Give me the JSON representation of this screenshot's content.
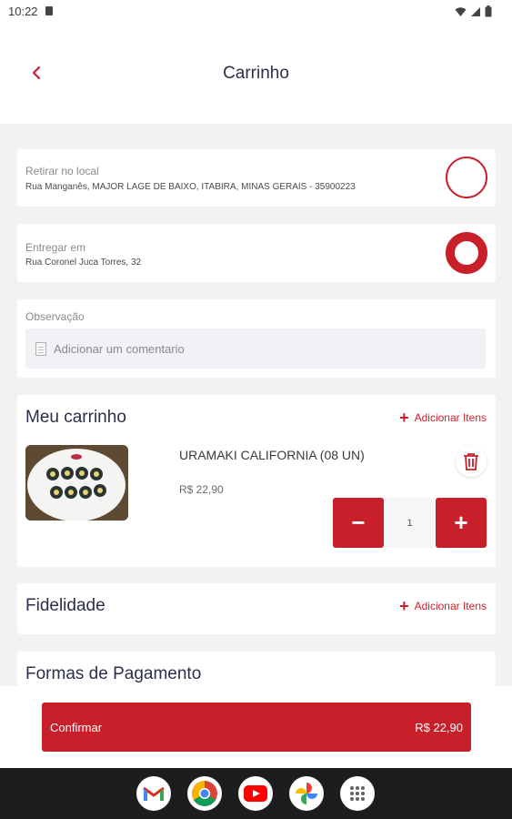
{
  "status_bar": {
    "time": "10:22"
  },
  "header": {
    "title": "Carrinho"
  },
  "pickup": {
    "label": "Retirar no local",
    "address": "Rua Manganês, MAJOR LAGE DE BAIXO, ITABIRA, MINAS GERAIS - 35900223",
    "selected": false
  },
  "delivery": {
    "label": "Entregar em",
    "address": "Rua Coronel Juca Torres, 32",
    "selected": true
  },
  "observation": {
    "label": "Observação",
    "placeholder": "Adicionar um comentario"
  },
  "cart": {
    "title": "Meu carrinho",
    "add_label": "Adicionar Itens",
    "items": [
      {
        "name": "URAMAKI CALIFORNIA (08 UN)",
        "price": "R$ 22,90",
        "quantity": "1"
      }
    ]
  },
  "loyalty": {
    "title": "Fidelidade",
    "add_label": "Adicionar Itens"
  },
  "payment": {
    "title": "Formas de Pagamento"
  },
  "confirm": {
    "label": "Confirmar",
    "total": "R$ 22,90"
  },
  "colors": {
    "accent": "#c8202a",
    "title_text": "#2b2f4a",
    "background": "#f2f2f2"
  },
  "dock_apps": [
    "gmail-icon",
    "chrome-icon",
    "youtube-icon",
    "photos-icon",
    "app-drawer-icon"
  ]
}
